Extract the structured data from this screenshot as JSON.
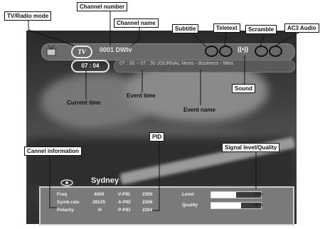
{
  "channel": {
    "mode_badge": "TV",
    "number_name": "0001  DWtv"
  },
  "event": {
    "current_time": "07 : 04",
    "event_line": "07 : 00 ~ 07 : 30  JOURNAL News - Business - Wea"
  },
  "info_panel": {
    "location": "Sydney",
    "rows": [
      {
        "label": "Freq",
        "value": "4000",
        "pid_label": "V-PID",
        "pid_value": "2305"
      },
      {
        "label": "Symb.rate",
        "value": "28125",
        "pid_label": "A-PID",
        "pid_value": "2306"
      },
      {
        "label": "Polarity",
        "value": "H",
        "pid_label": "P-PID",
        "pid_value": "2304"
      }
    ],
    "level": {
      "label": "Level",
      "percent": 50,
      "text": "50%"
    },
    "quality": {
      "label": "Quality",
      "percent": 60,
      "text": "60%"
    }
  },
  "callouts": {
    "tv_radio_mode": "TV/Radio mode",
    "channel_number": "Channel number",
    "channel_name": "Channel name",
    "subtitle": "Subtitle",
    "teletext": "Teletext",
    "scramble": "Scramble",
    "ac3_audio": "AC3 Audio",
    "sound": "Sound",
    "current_time": "Current time",
    "event_time": "Event time",
    "event_name": "Event name",
    "channel_information": "Cannel information",
    "pid": "PID",
    "signal": "Signal level/Quality"
  }
}
